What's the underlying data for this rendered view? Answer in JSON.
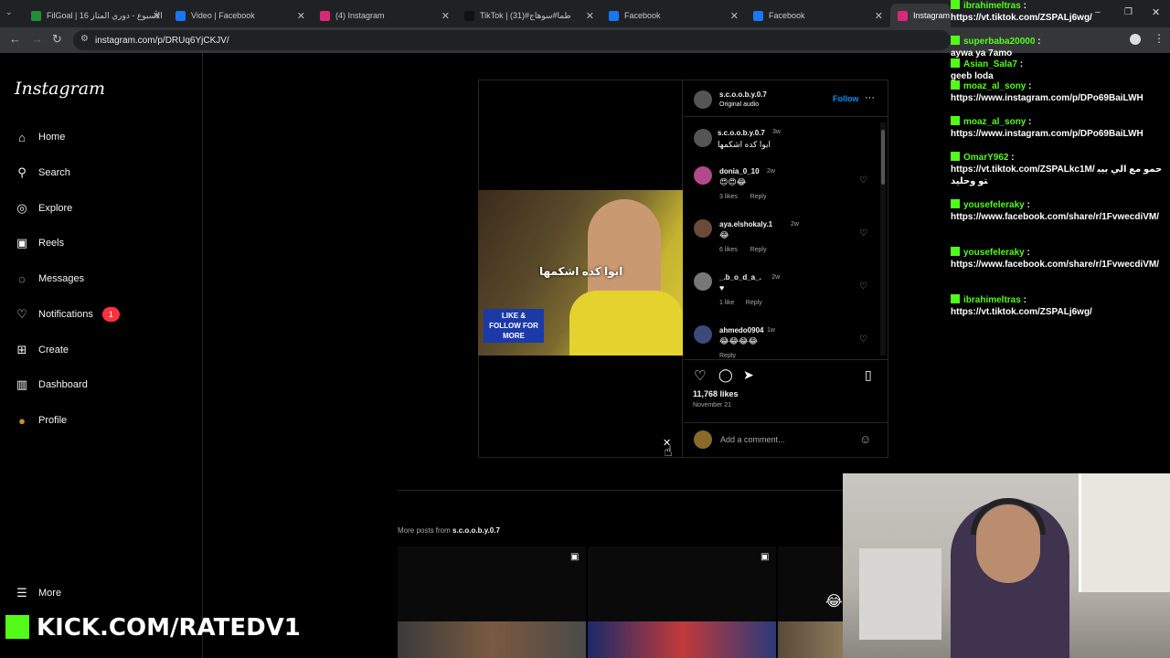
{
  "browser": {
    "tabs": [
      {
        "title": "FilGoal | 16 الأسبوع - دوري المتاز",
        "icon": "filgoal-icon",
        "fav_color": "#1f8f3a"
      },
      {
        "title": "Video | Facebook",
        "icon": "facebook-icon",
        "fav_color": "#1877f2"
      },
      {
        "title": "(4) Instagram",
        "icon": "instagram-icon",
        "fav_color": "#d62976"
      },
      {
        "title": "TikTok | طما#سوهاج#(31)",
        "icon": "tiktok-icon",
        "fav_color": "#111111"
      },
      {
        "title": "Facebook",
        "icon": "facebook-icon",
        "fav_color": "#1877f2"
      },
      {
        "title": "Facebook",
        "icon": "facebook-icon",
        "fav_color": "#1877f2"
      },
      {
        "title": "Instagram",
        "icon": "instagram-icon",
        "fav_color": "#d62976"
      }
    ],
    "url": "instagram.com/p/DRUq6YjCKJV/"
  },
  "instagram": {
    "logo": "Instagram",
    "nav": [
      {
        "label": "Home",
        "icon": "home-icon",
        "glyph": "⌂"
      },
      {
        "label": "Search",
        "icon": "search-icon",
        "glyph": "⚲"
      },
      {
        "label": "Explore",
        "icon": "compass-icon",
        "glyph": "◎"
      },
      {
        "label": "Reels",
        "icon": "reels-icon",
        "glyph": "▣"
      },
      {
        "label": "Messages",
        "icon": "messenger-icon",
        "glyph": "◌"
      },
      {
        "label": "Notifications",
        "icon": "heart-icon",
        "glyph": "♡",
        "badge": "1"
      },
      {
        "label": "Create",
        "icon": "plus-square-icon",
        "glyph": "⊞"
      },
      {
        "label": "Dashboard",
        "icon": "dashboard-icon",
        "glyph": "▥"
      },
      {
        "label": "Profile",
        "icon": "profile-avatar",
        "glyph": "●"
      }
    ],
    "more": "More",
    "post": {
      "author": "s.c.o.o.b.y.0.7",
      "audio": "Original audio",
      "follow": "Follow",
      "caption_user": "s.c.o.o.b.y.0.7",
      "caption_time": "3w",
      "caption": "ابوا كده اشكمها",
      "video_caption": "ابوا كده اشكمها",
      "video_overlay": "LIKE & FOLLOW FOR MORE",
      "comments": [
        {
          "user": "donia_0_10",
          "time": "2w",
          "text": "😍😍😂",
          "likes": "3 likes",
          "reply": "Reply"
        },
        {
          "user": "aya.elshokaly.1",
          "time": "2w",
          "text": "😂",
          "likes": "6 likes",
          "reply": "Reply"
        },
        {
          "user": "_.b_o_d_a_.",
          "time": "2w",
          "text": "♥",
          "likes": "1 like",
          "reply": "Reply"
        },
        {
          "user": "ahmedo0904",
          "time": "1w",
          "text": "😂😂😂😂",
          "likes": "",
          "reply": "Reply"
        }
      ],
      "likes": "11,768 likes",
      "date": "November 21",
      "add_comment": "Add a comment..."
    },
    "more_posts_prefix": "More posts from ",
    "more_posts_user": "s.c.o.o.b.y.0.7"
  },
  "chat": [
    {
      "user": "ibrahimeltras",
      "msg": "https://vt.tiktok.com/ZSPALj6wg/"
    },
    {
      "user": "superbaba20000",
      "msg": "aywa ya 7amo"
    },
    {
      "user": "Asian_Sala7",
      "msg": "geeb loda"
    },
    {
      "user": "moaz_al_sony",
      "msg": "https://www.instagram.com/p/DPo69BaiLWH"
    },
    {
      "user": "moaz_al_sony",
      "msg": "https://www.instagram.com/p/DPo69BaiLWH"
    },
    {
      "user": "OmarY962",
      "msg": "https://vt.tiktok.com/ZSPALkc1M/ حمو مع الي بيبتو وحليد"
    },
    {
      "user": "yousefeleraky",
      "msg": "https://www.facebook.com/share/r/1FvwecdiVM/"
    },
    {
      "user": "yousefeleraky",
      "msg": "https://www.facebook.com/share/r/1FvwecdiVM/"
    },
    {
      "user": "ibrahimeltras",
      "msg": "https://vt.tiktok.com/ZSPALj6wg/"
    }
  ],
  "stream": {
    "kick_url": "KICK.COM/RATEDV1"
  },
  "colors": {
    "kick_green": "#53fc18",
    "ig_blue": "#0095f6",
    "badge_red": "#ff3040"
  }
}
